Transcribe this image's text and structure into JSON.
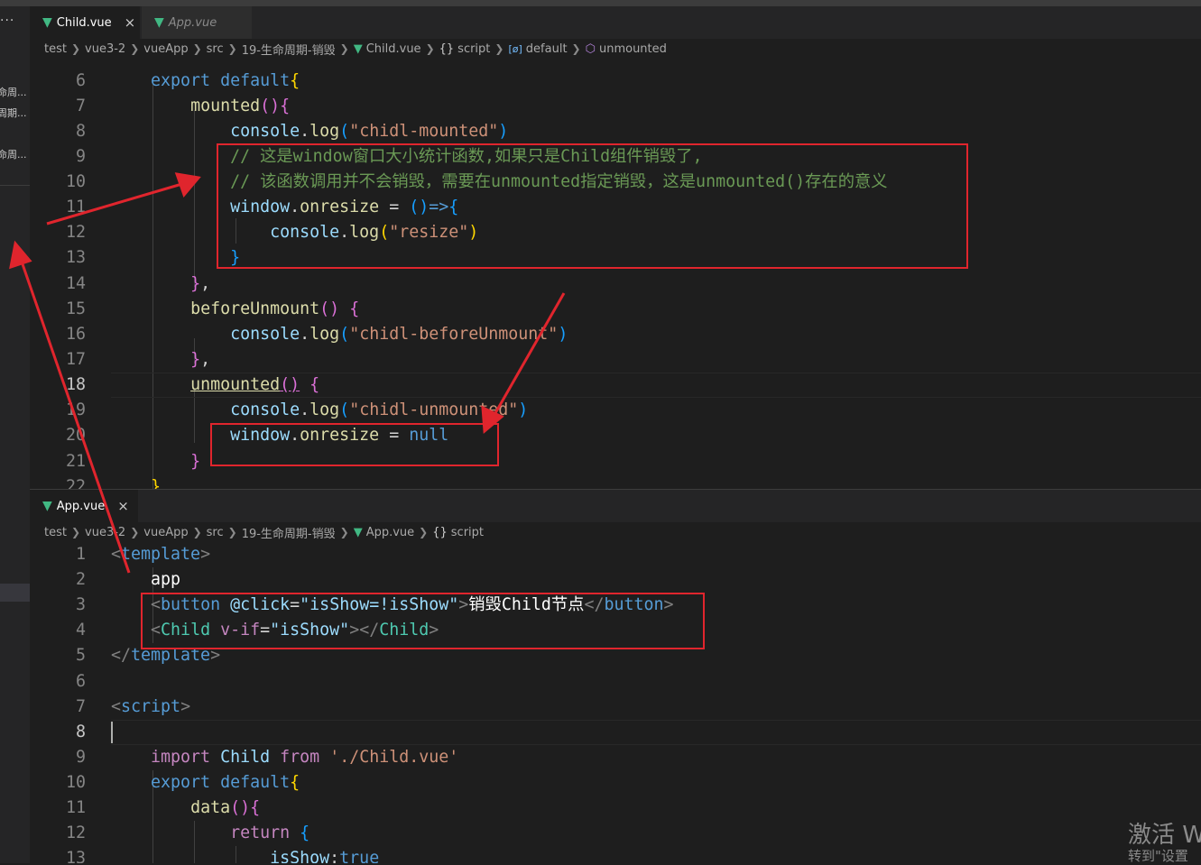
{
  "sidebar": {
    "dots": "···",
    "items": [
      "命周...",
      "周期...",
      "命周..."
    ]
  },
  "top_editor": {
    "tabs": [
      {
        "label": "Child.vue",
        "close": "×"
      },
      {
        "label": "App.vue"
      }
    ],
    "breadcrumb": [
      "test",
      "vue3-2",
      "vueApp",
      "src",
      "19-生命周期-销毁",
      "Child.vue",
      "script",
      "default",
      "unmounted"
    ],
    "breadcrumb_icons": {
      "vue": "▼",
      "script": "{}",
      "default": "[ø]",
      "unmounted": "⬡"
    },
    "lines": {
      "n6": "6",
      "n7": "7",
      "n8": "8",
      "n9": "9",
      "n10": "10",
      "n11": "11",
      "n12": "12",
      "n13": "13",
      "n14": "14",
      "n15": "15",
      "n16": "16",
      "n17": "17",
      "n18": "18",
      "n19": "19",
      "n20": "20",
      "n21": "21",
      "n22": "22",
      "l6_kw": "export",
      "l6_kw2": "default",
      "l6_br": "{",
      "l7_fn": "mounted",
      "l7_br": "()",
      "l7_br2": "{",
      "l8_obj": "console",
      "l8_dot": ".",
      "l8_fn": "log",
      "l8_p1": "(",
      "l8_str": "\"chidl-mounted\"",
      "l8_p2": ")",
      "l9_cm": "// 这是window窗口大小统计函数,如果只是Child组件销毁了,",
      "l10_cm": "// 该函数调用并不会销毁，需要在unmounted指定销毁，这是unmounted()存在的意义",
      "l11_obj": "window",
      "l11_dot": ".",
      "l11_prop": "onresize",
      "l11_eq": " = ",
      "l11_p": "()",
      "l11_arrow": "=>",
      "l11_br": "{",
      "l12_obj": "console",
      "l12_dot": ".",
      "l12_fn": "log",
      "l12_p1": "(",
      "l12_str": "\"resize\"",
      "l12_p2": ")",
      "l13_br": "}",
      "l14_br": "}",
      "l14_c": ",",
      "l15_fn": "beforeUnmount",
      "l15_p": "()",
      "l15_br": "{",
      "l16_obj": "console",
      "l16_dot": ".",
      "l16_fn": "log",
      "l16_p1": "(",
      "l16_str": "\"chidl-beforeUnmount\"",
      "l16_p2": ")",
      "l17_br": "}",
      "l17_c": ",",
      "l18_fn": "unmounted",
      "l18_p": "()",
      "l18_br": "{",
      "l19_obj": "console",
      "l19_dot": ".",
      "l19_fn": "log",
      "l19_p1": "(",
      "l19_str": "\"chidl-unmounted\"",
      "l19_p2": ")",
      "l20_obj": "window",
      "l20_dot": ".",
      "l20_prop": "onresize",
      "l20_eq": " = ",
      "l20_null": "null",
      "l21_br": "}",
      "l22_br": "}"
    }
  },
  "bottom_editor": {
    "tab": {
      "label": "App.vue",
      "close": "×"
    },
    "breadcrumb": [
      "test",
      "vue3-2",
      "vueApp",
      "src",
      "19-生命周期-销毁",
      "App.vue",
      "script"
    ],
    "lines": {
      "n1": "1",
      "n2": "2",
      "n3": "3",
      "n4": "4",
      "n5": "5",
      "n6": "6",
      "n7": "7",
      "n8": "8",
      "n9": "9",
      "n10": "10",
      "n11": "11",
      "n12": "12",
      "n13": "13",
      "l1_lt": "<",
      "l1_tag": "template",
      "l1_gt": ">",
      "l2_txt": "app",
      "l3_lt": "<",
      "l3_tag": "button",
      "l3_attr": "@click",
      "l3_eq": "=",
      "l3_val": "\"isShow=!isShow\"",
      "l3_gt": ">",
      "l3_txt": "销毁Child节点",
      "l3_lt2": "</",
      "l3_tag2": "button",
      "l3_gt2": ">",
      "l4_lt": "<",
      "l4_tag": "Child",
      "l4_attr": "v-if",
      "l4_eq": "=",
      "l4_val": "\"isShow\"",
      "l4_gt": "></",
      "l4_tag2": "Child",
      "l4_gt2": ">",
      "l5_lt": "</",
      "l5_tag": "template",
      "l5_gt": ">",
      "l7_lt": "<",
      "l7_tag": "script",
      "l7_gt": ">",
      "l9_kw": "import",
      "l9_cls": "Child",
      "l9_from": "from",
      "l9_str": "'./Child.vue'",
      "l10_kw": "export",
      "l10_kw2": "default",
      "l10_br": "{",
      "l11_fn": "data",
      "l11_p": "()",
      "l11_br": "{",
      "l12_kw": "return",
      "l12_br": "{",
      "l13_prop": "isShow",
      "l13_colon": ":",
      "l13_val": "true"
    }
  },
  "watermark": {
    "line1": "激活 W",
    "line2": "转到\"设置"
  },
  "colors": {
    "annotation": "#e0252d",
    "vue_green": "#41b883",
    "background": "#1e1e1e"
  }
}
